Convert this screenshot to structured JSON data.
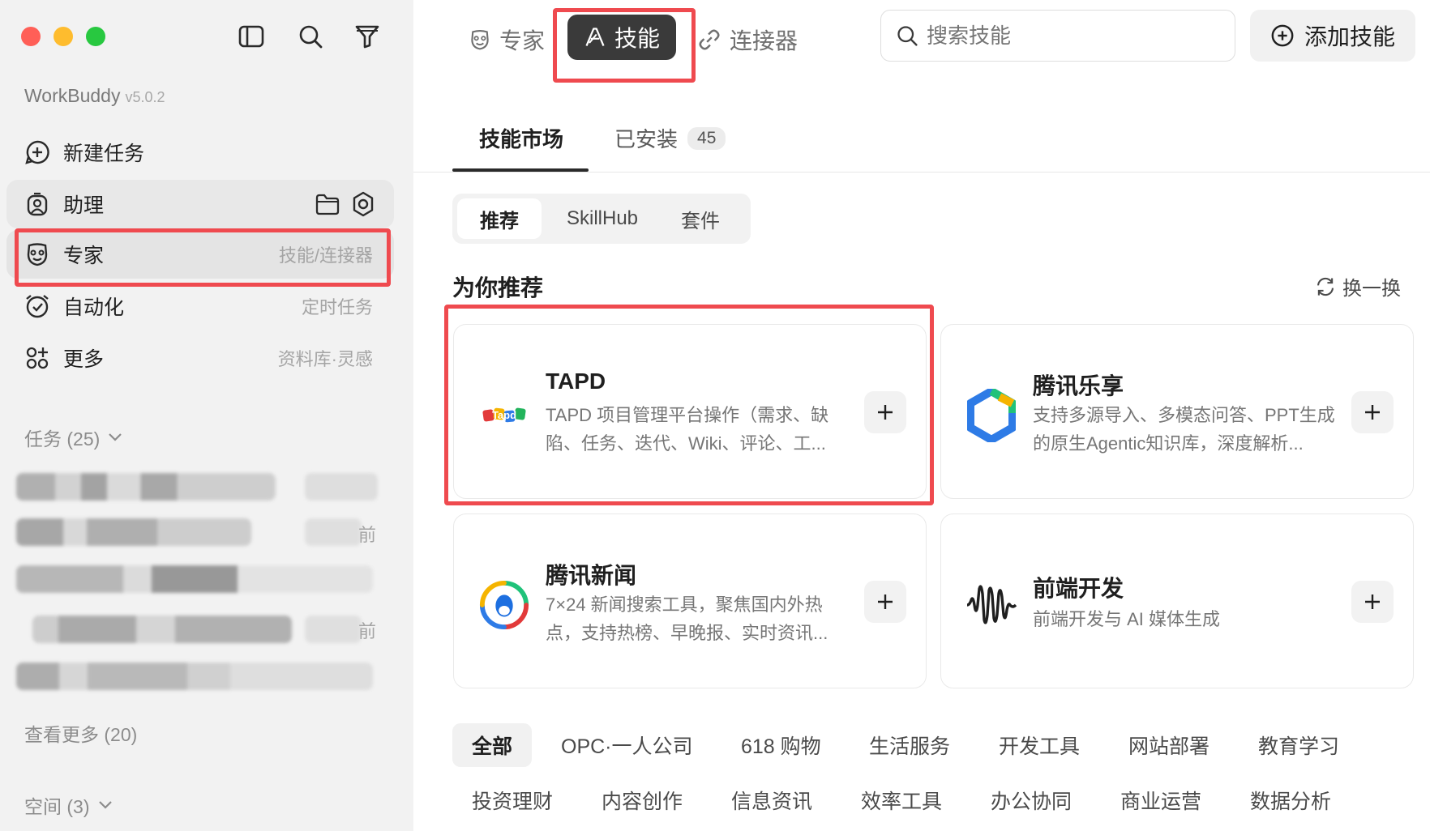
{
  "sidebar": {
    "app_name": "WorkBuddy",
    "version": "v5.0.2",
    "nav": [
      {
        "label": "新建任务",
        "icon": "new-task-icon",
        "hint": ""
      },
      {
        "label": "助理",
        "icon": "assistant-icon",
        "hint": ""
      },
      {
        "label": "专家",
        "icon": "expert-icon",
        "hint": "技能/连接器"
      },
      {
        "label": "自动化",
        "icon": "alarm-clock-icon",
        "hint": "定时任务"
      },
      {
        "label": "更多",
        "icon": "more-grid-icon",
        "hint": "资料库·灵感"
      }
    ],
    "tasks_header": "任务 (25)",
    "partial_text_1": "前",
    "partial_text_2": "前",
    "see_more": "查看更多 (20)",
    "spaces_header": "空间 (3)"
  },
  "topbar": {
    "tabs": [
      "专家",
      "技能",
      "连接器"
    ],
    "active_tab": "技能",
    "search_placeholder": "搜索技能",
    "add_button": "添加技能"
  },
  "subtabs": {
    "market": "技能市场",
    "installed": "已安装",
    "installed_count": "45"
  },
  "segments": [
    "推荐",
    "SkillHub",
    "套件"
  ],
  "recommend": {
    "title": "为你推荐",
    "refresh": "换一换"
  },
  "cards": [
    {
      "name": "TAPD",
      "desc": "TAPD 项目管理平台操作（需求、缺陷、任务、迭代、Wiki、评论、工...",
      "logo_text": "Tapd"
    },
    {
      "name": "腾讯乐享",
      "desc": "支持多源导入、多模态问答、PPT生成的原生Agentic知识库，深度解析...",
      "logo_text": ""
    },
    {
      "name": "腾讯新闻",
      "desc": "7×24 新闻搜索工具，聚焦国内外热点，支持热榜、早晚报、实时资讯...",
      "logo_text": ""
    },
    {
      "name": "前端开发",
      "desc": "前端开发与 AI 媒体生成",
      "logo_text": ""
    }
  ],
  "categories_row1": [
    "全部",
    "OPC·一人公司",
    "618 购物",
    "生活服务",
    "开发工具",
    "网站部署",
    "教育学习"
  ],
  "categories_row2": [
    "投资理财",
    "内容创作",
    "信息资讯",
    "效率工具",
    "办公协同",
    "商业运营",
    "数据分析"
  ],
  "colors": {
    "highlight_red": "#ef4a4f",
    "active_tab_bg": "#3a3a3a",
    "sidebar_bg": "#f2f2f2"
  }
}
